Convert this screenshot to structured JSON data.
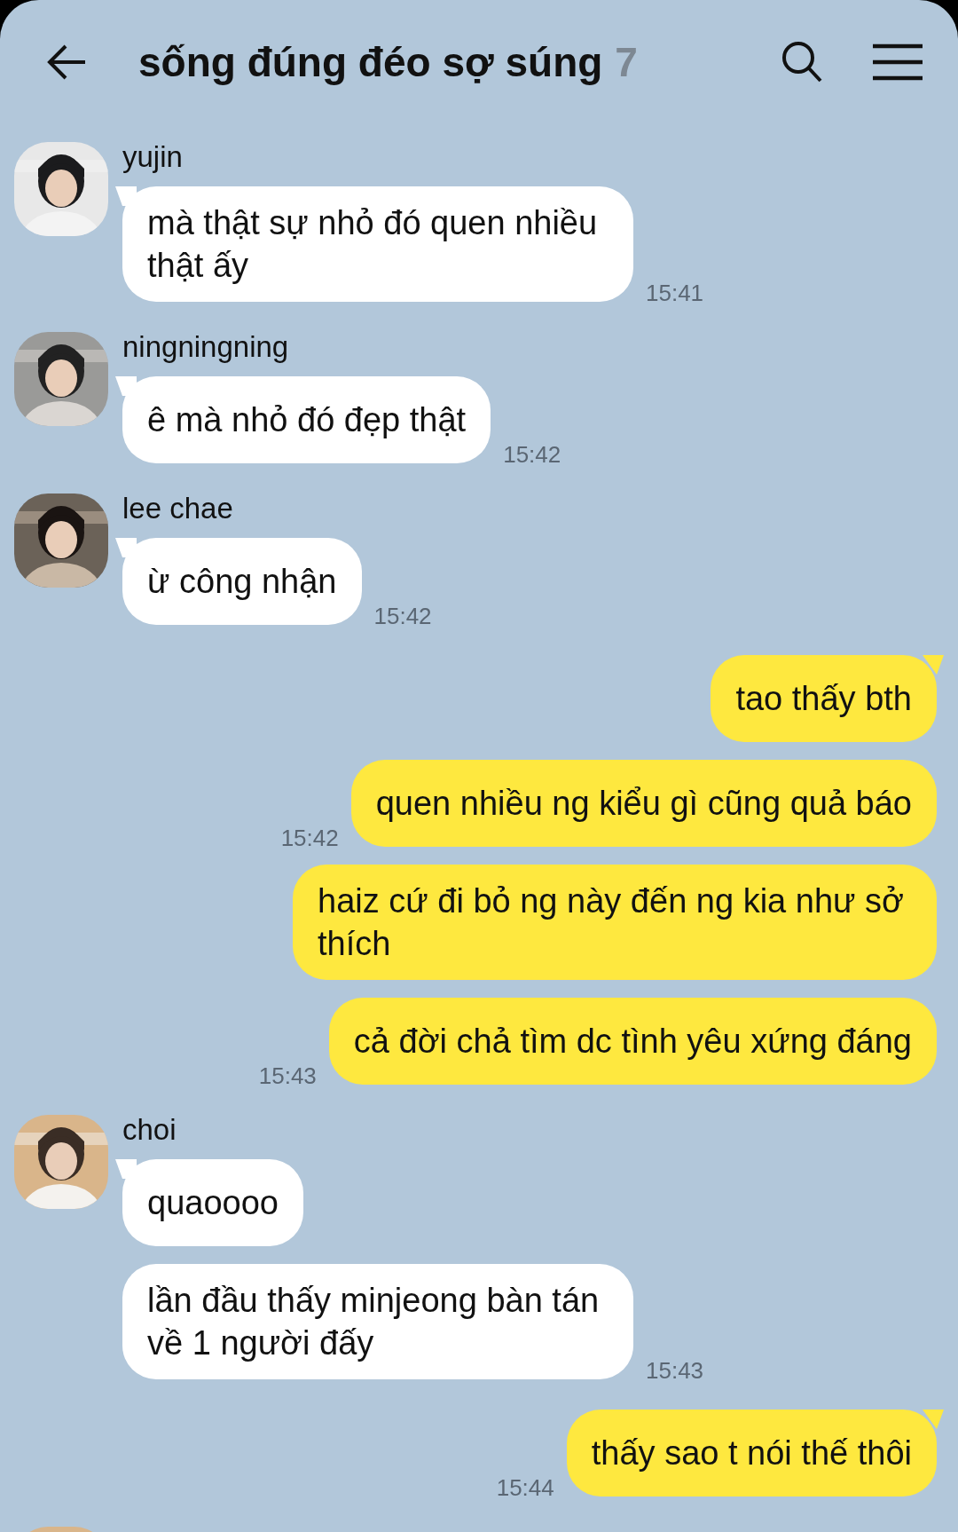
{
  "header": {
    "title": "sống đúng đéo sợ súng",
    "member_count": "7"
  },
  "messages": [
    {
      "kind": "incoming",
      "sender": "yujin",
      "bubbles": [
        {
          "text": "mà thật sự nhỏ đó quen nhiều thật ấy",
          "time": "15:41"
        }
      ]
    },
    {
      "kind": "incoming",
      "sender": "ningningning",
      "bubbles": [
        {
          "text": "ê mà nhỏ đó đẹp thật",
          "time": "15:42"
        }
      ]
    },
    {
      "kind": "incoming",
      "sender": "lee chae",
      "bubbles": [
        {
          "text": "ừ công nhận",
          "time": "15:42"
        }
      ]
    },
    {
      "kind": "outgoing",
      "bubbles": [
        {
          "text": "tao thấy bth"
        },
        {
          "text": "quen nhiều ng kiểu gì cũng quả báo",
          "time": "15:42"
        },
        {
          "text": "haiz cứ đi bỏ ng này đến ng kia như sở thích"
        },
        {
          "text": "cả đời chả tìm dc tình yêu xứng đáng",
          "time": "15:43"
        }
      ]
    },
    {
      "kind": "incoming",
      "sender": "choi",
      "bubbles": [
        {
          "text": "quaoooo"
        },
        {
          "text": "lần đầu thấy minjeong bàn tán về 1 người đấy",
          "time": "15:43"
        }
      ]
    },
    {
      "kind": "outgoing",
      "bubbles": [
        {
          "text": "thấy sao t nói thế thôi",
          "time": "15:44"
        }
      ]
    }
  ]
}
